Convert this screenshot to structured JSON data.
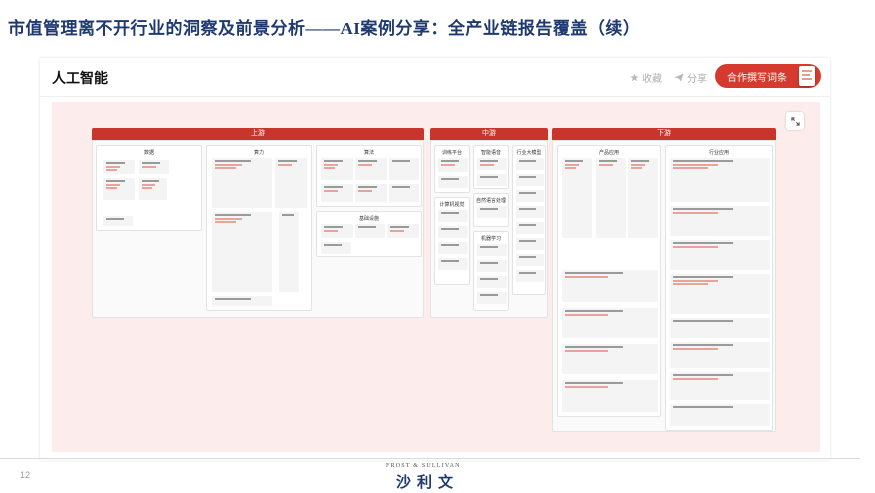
{
  "slide": {
    "title": "市值管理离不开行业的洞察及前景分析——AI案例分享：全产业链报告覆盖（续）",
    "page_number": "12"
  },
  "app": {
    "brand": "人工智能",
    "favorite_label": "收藏",
    "share_label": "分享",
    "cta_label": "合作撰写词条"
  },
  "stages": [
    {
      "label": "上游",
      "panels": [
        "数据",
        "算力",
        "算法",
        "基础设施"
      ]
    },
    {
      "label": "中游",
      "panels": [
        "训练平台",
        "计算机视觉",
        "智能语音",
        "自然语言处理",
        "机器学习",
        "行业大模型"
      ]
    },
    {
      "label": "下游",
      "panels": [
        "产品应用",
        "行业应用"
      ]
    }
  ],
  "footer": {
    "logo_en": "FROST & SULLIVAN",
    "logo_zh": "沙利文"
  },
  "colors": {
    "accent": "#d63a2e",
    "stage_bar": "#c8352c",
    "title": "#1f3a70",
    "canvas_bg": "#fdecec"
  },
  "icons": [
    "star-icon",
    "share-icon",
    "document-icon",
    "expand-icon"
  ]
}
